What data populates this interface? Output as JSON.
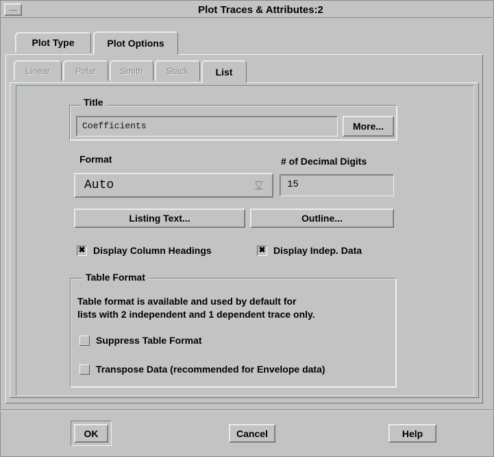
{
  "window": {
    "title": "Plot Traces & Attributes:2",
    "menu_glyph": "—"
  },
  "outer_tabs": [
    {
      "label": "Plot Type"
    },
    {
      "label": "Plot Options"
    }
  ],
  "inner_tabs": [
    {
      "label": "Linear"
    },
    {
      "label": "Polar"
    },
    {
      "label": "Smith"
    },
    {
      "label": "Stack"
    },
    {
      "label": "List"
    }
  ],
  "title_group": {
    "legend": "Title",
    "value": "Coefficients",
    "more_label": "More..."
  },
  "format": {
    "label": "Format",
    "value": "Auto",
    "arrow": "▽"
  },
  "decimal_digits": {
    "label": "# of Decimal Digits",
    "value": "15"
  },
  "buttons": {
    "listing_text": "Listing Text...",
    "outline": "Outline..."
  },
  "checkboxes": {
    "column_headings": {
      "label": "Display Column Headings",
      "checked": true,
      "mark": "✖"
    },
    "indep_data": {
      "label": "Display Indep. Data",
      "checked": true,
      "mark": "✖"
    }
  },
  "table_format": {
    "legend": "Table Format",
    "info_line1": "Table format is available and used by default for",
    "info_line2": "lists with 2 independent and 1 dependent trace only.",
    "suppress": {
      "label": "Suppress Table Format",
      "checked": false
    },
    "transpose": {
      "label": "Transpose Data (recommended for Envelope data)",
      "checked": false
    }
  },
  "footer": {
    "ok": "OK",
    "cancel": "Cancel",
    "help": "Help"
  }
}
